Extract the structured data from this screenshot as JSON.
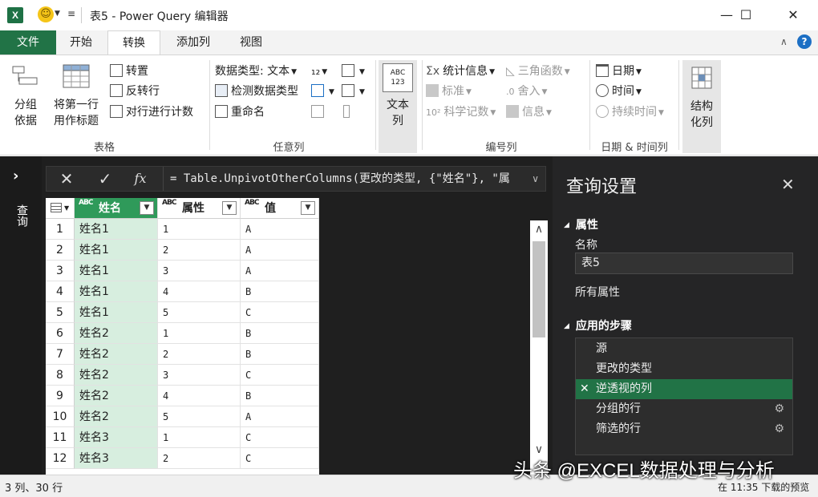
{
  "window": {
    "title": "表5 - Power Query 编辑器",
    "app_icon": "excel-icon",
    "controls": [
      "minimize-icon",
      "maximize-icon",
      "close-icon"
    ]
  },
  "ribbon_tabs": {
    "file": "文件",
    "tabs": [
      "开始",
      "转换",
      "添加列",
      "视图"
    ],
    "active": "转换"
  },
  "ribbon": {
    "table_group": {
      "label": "表格",
      "group_by": "分组\n依据",
      "use_first_row": "将第一行\n用作标题",
      "transpose": "转置",
      "reverse_rows": "反转行",
      "count_rows": "对行进行计数"
    },
    "any_column_group": {
      "label": "任意列",
      "data_type": "数据类型: 文本",
      "detect_type": "检测数据类型",
      "rename": "重命名"
    },
    "text_column": {
      "label": "文本\n列",
      "icon_text_top": "ABC",
      "icon_text_bottom": "123"
    },
    "number_group": {
      "label": "编号列",
      "statistics": "统计信息",
      "standard": "标准",
      "scientific": "科学记数",
      "trig": "三角函数",
      "rounding": "舍入",
      "info": "信息"
    },
    "datetime_group": {
      "label": "日期 & 时间列",
      "date": "日期",
      "time": "时间",
      "duration": "持续时间"
    },
    "structured_column": {
      "label": "结构\n化列"
    }
  },
  "left_nav": {
    "label": "查询"
  },
  "formula_bar": {
    "formula": "= Table.UnpivotOtherColumns(更改的类型, {\"姓名\"}, \"属"
  },
  "grid": {
    "columns": [
      "姓名",
      "属性",
      "值"
    ],
    "type_badge": "ABC",
    "rows": [
      [
        "1",
        "姓名1",
        "1",
        "A"
      ],
      [
        "2",
        "姓名1",
        "2",
        "A"
      ],
      [
        "3",
        "姓名1",
        "3",
        "A"
      ],
      [
        "4",
        "姓名1",
        "4",
        "B"
      ],
      [
        "5",
        "姓名1",
        "5",
        "C"
      ],
      [
        "6",
        "姓名2",
        "1",
        "B"
      ],
      [
        "7",
        "姓名2",
        "2",
        "B"
      ],
      [
        "8",
        "姓名2",
        "3",
        "C"
      ],
      [
        "9",
        "姓名2",
        "4",
        "B"
      ],
      [
        "10",
        "姓名2",
        "5",
        "A"
      ],
      [
        "11",
        "姓名3",
        "1",
        "C"
      ],
      [
        "12",
        "姓名3",
        "2",
        "C"
      ]
    ]
  },
  "query_settings": {
    "title": "查询设置",
    "properties_header": "属性",
    "name_label": "名称",
    "name_value": "表5",
    "all_properties": "所有属性",
    "steps_header": "应用的步骤",
    "steps": [
      "源",
      "更改的类型",
      "逆透视的列",
      "分组的行",
      "筛选的行"
    ],
    "selected_step": "逆透视的列"
  },
  "status": {
    "left": "3 列、30 行",
    "right": "在 11:35 下载的预览"
  },
  "watermark": "头条 @EXCEL数据处理与分析",
  "colors": {
    "excel_green": "#217346",
    "selected_column": "#2f9a5a",
    "column_fill": "#d7eedf"
  }
}
